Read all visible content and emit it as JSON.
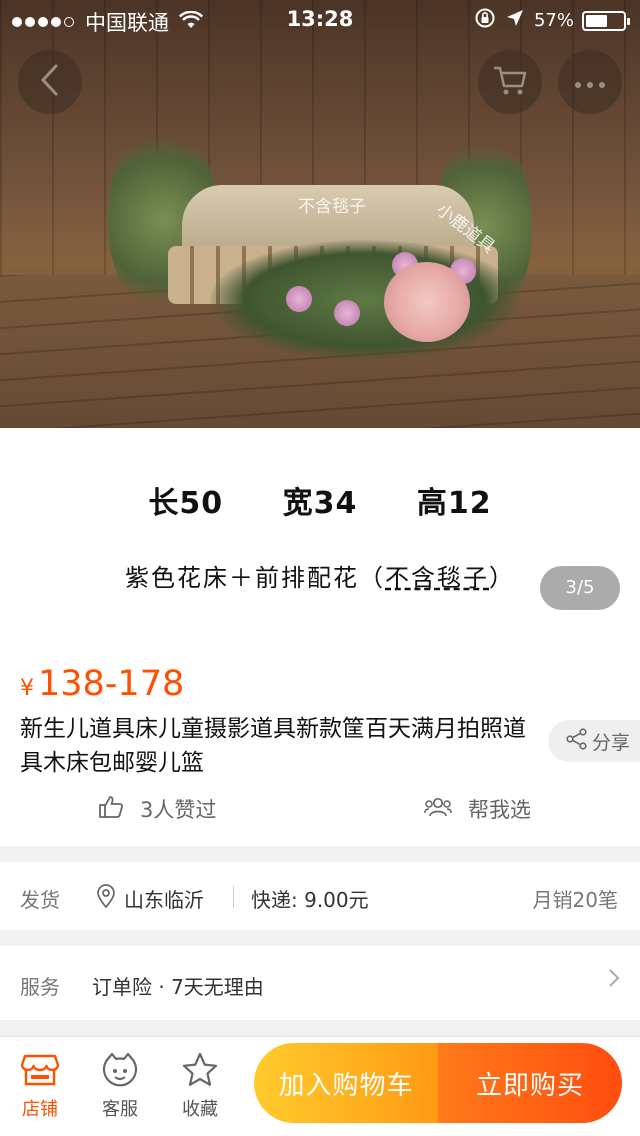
{
  "status_bar": {
    "carrier": "中国联通",
    "time": "13:28",
    "battery": "57%",
    "battery_level": 0.57
  },
  "nav": {
    "back_icon": "chevron-left-icon",
    "cart_icon": "cart-icon",
    "more_icon": "more-dots-icon"
  },
  "gallery": {
    "watermark_1": "不含毯子",
    "watermark_2": "小鹿道具",
    "dimensions": [
      "长50",
      "宽34",
      "高12"
    ],
    "caption_main": "紫色花床＋前排配花（",
    "caption_note": "不含毯子",
    "caption_end": "）",
    "counter": "3/5"
  },
  "product": {
    "currency": "¥",
    "price": "138-178",
    "title": "新生儿道具床儿童摄影道具新款筐百天满月拍照道具木床包邮婴儿篮",
    "share_label": "分享",
    "likes_label": "3人赞过",
    "help_choose_label": "帮我选"
  },
  "delivery": {
    "label": "发货",
    "location": "山东临沂",
    "shipping": "快递: 9.00元",
    "monthly_sales": "月销20笔"
  },
  "service": {
    "label": "服务",
    "value": "订单险 · 7天无理由"
  },
  "bottom_bar": {
    "store_label": "店铺",
    "customer_service_label": "客服",
    "favorite_label": "收藏",
    "add_to_cart_label": "加入购物车",
    "buy_now_label": "立即购买"
  },
  "colors": {
    "accent": "#ff5000",
    "cart_button": "#ffa414",
    "buy_button": "#ff5a14"
  }
}
